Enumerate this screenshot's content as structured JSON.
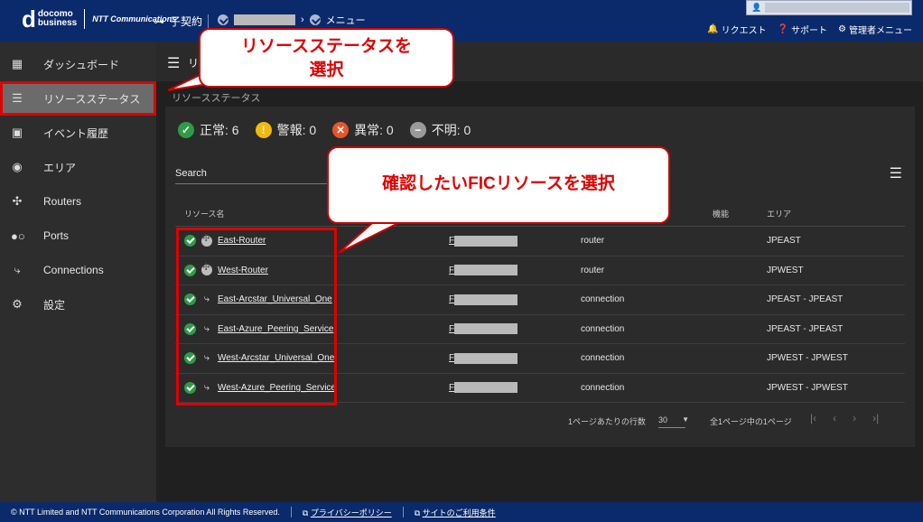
{
  "header": {
    "logo_main": "d",
    "logo_line1": "docomo",
    "logo_line2": "business",
    "logo_ntt": "NTT Communications",
    "contract": "子契約",
    "menu": "メニュー",
    "links": [
      "リクエスト",
      "サポート",
      "管理者メニュー"
    ]
  },
  "sidebar": {
    "items": [
      {
        "label": "ダッシュボード",
        "icon": "grid-icon"
      },
      {
        "label": "リソースステータス",
        "icon": "list-check-icon"
      },
      {
        "label": "イベント履歴",
        "icon": "calendar-check-icon"
      },
      {
        "label": "エリア",
        "icon": "globe-icon"
      },
      {
        "label": "Routers",
        "icon": "router-icon"
      },
      {
        "label": "Ports",
        "icon": "port-icon"
      },
      {
        "label": "Connections",
        "icon": "connection-icon"
      },
      {
        "label": "設定",
        "icon": "gear-icon"
      }
    ]
  },
  "main": {
    "title_partial": "リ",
    "breadcrumb": "リソースステータス",
    "summary": [
      {
        "label": "正常: 6",
        "color": "#2e9c48"
      },
      {
        "label": "警報: 0",
        "color": "#f2b90f"
      },
      {
        "label": "異常: 0",
        "color": "#e8542a"
      },
      {
        "label": "不明: 0",
        "color": "#9a9a9a"
      }
    ],
    "search_label": "Search",
    "table": {
      "headers": {
        "name": "リソース名",
        "func": "機能",
        "area": "エリア"
      },
      "rows": [
        {
          "name": "East-Router",
          "fic": "F",
          "func": "router",
          "area": "JPEAST",
          "type": "router"
        },
        {
          "name": "West-Router",
          "fic": "F",
          "func": "router",
          "area": "JPWEST",
          "type": "router"
        },
        {
          "name": "East-Arcstar_Universal_One",
          "fic": "F",
          "func": "connection",
          "area": "JPEAST - JPEAST",
          "type": "connection"
        },
        {
          "name": "East-Azure_Peering_Service",
          "fic": "F",
          "func": "connection",
          "area": "JPEAST - JPEAST",
          "type": "connection"
        },
        {
          "name": "West-Arcstar_Universal_One",
          "fic": "F",
          "func": "connection",
          "area": "JPWEST - JPWEST",
          "type": "connection"
        },
        {
          "name": "West-Azure_Peering_Service",
          "fic": "F",
          "func": "connection",
          "area": "JPWEST - JPWEST",
          "type": "connection"
        }
      ]
    },
    "pager": {
      "rows_per_page_label": "1ページあたりの行数",
      "rows_per_page": "30",
      "range": "全1ページ中の1ページ"
    }
  },
  "footer": {
    "copyright": "© NTT Limited and NTT Communications Corporation All Rights Reserved.",
    "privacy": "プライバシーポリシー",
    "terms": "サイトのご利用条件"
  },
  "callouts": {
    "first": "リソースステータスを選択",
    "second": "確認したいFICリソースを選択"
  }
}
